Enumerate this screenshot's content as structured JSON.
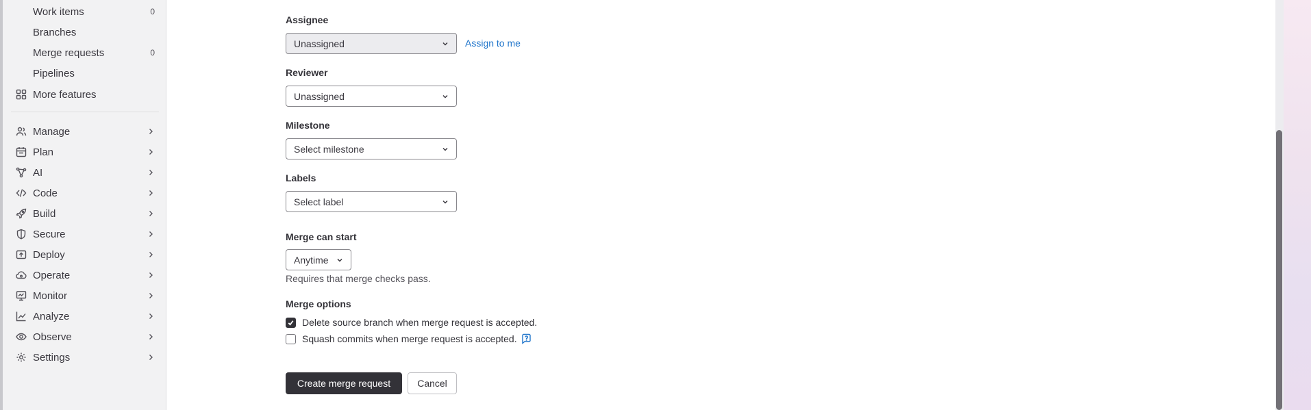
{
  "sidebar": {
    "top_items": [
      {
        "label": "Work items",
        "count": "0"
      },
      {
        "label": "Branches",
        "count": ""
      },
      {
        "label": "Merge requests",
        "count": "0"
      },
      {
        "label": "Pipelines",
        "count": ""
      }
    ],
    "more_features": "More features",
    "groups": [
      {
        "label": "Manage",
        "icon": "users-icon"
      },
      {
        "label": "Plan",
        "icon": "calendar-icon"
      },
      {
        "label": "AI",
        "icon": "ai-icon"
      },
      {
        "label": "Code",
        "icon": "code-icon"
      },
      {
        "label": "Build",
        "icon": "rocket-icon"
      },
      {
        "label": "Secure",
        "icon": "shield-icon"
      },
      {
        "label": "Deploy",
        "icon": "deploy-icon"
      },
      {
        "label": "Operate",
        "icon": "cloud-gear-icon"
      },
      {
        "label": "Monitor",
        "icon": "monitor-icon"
      },
      {
        "label": "Analyze",
        "icon": "chart-icon"
      },
      {
        "label": "Observe",
        "icon": "eye-icon"
      },
      {
        "label": "Settings",
        "icon": "gear-icon"
      }
    ]
  },
  "form": {
    "assignee": {
      "label": "Assignee",
      "value": "Unassigned",
      "assign_to_me": "Assign to me"
    },
    "reviewer": {
      "label": "Reviewer",
      "value": "Unassigned"
    },
    "milestone": {
      "label": "Milestone",
      "value": "Select milestone"
    },
    "labels": {
      "label": "Labels",
      "value": "Select label"
    },
    "merge_can_start": {
      "label": "Merge can start",
      "value": "Anytime",
      "help": "Requires that merge checks pass."
    },
    "merge_options": {
      "label": "Merge options",
      "delete_source": {
        "label": "Delete source branch when merge request is accepted.",
        "checked": true
      },
      "squash": {
        "label": "Squash commits when merge request is accepted.",
        "checked": false
      }
    },
    "buttons": {
      "create": "Create merge request",
      "cancel": "Cancel"
    }
  },
  "colors": {
    "link": "#1f75cb",
    "primary_button": "#333238",
    "sidebar_bg": "#f2f2f3"
  }
}
